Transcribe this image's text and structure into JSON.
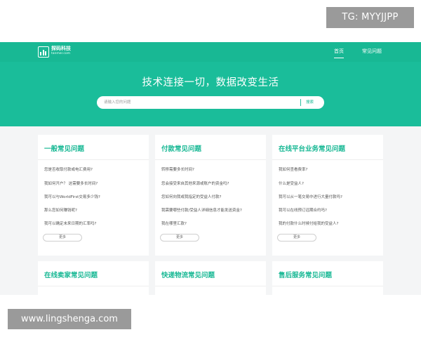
{
  "watermarks": {
    "top": "TG: MYYJJPP",
    "bottom": "www.lingshenga.com"
  },
  "header": {
    "logo_title": "探码科技",
    "logo_subtitle": "tanmer.com",
    "nav": [
      {
        "label": "首页",
        "active": true
      },
      {
        "label": "常见问题",
        "active": false
      }
    ]
  },
  "hero": {
    "title": "技术连接一切，数据改变生活",
    "search": {
      "placeholder": "请输入您的问题",
      "button": "搜索"
    }
  },
  "cards": [
    {
      "title": "一般常见问题",
      "questions": [
        "您是否收取付款或电汇费用?",
        "我如何开户？ 这需要多长时间?",
        "我可以与WorldFirst交易多少钱?",
        "那么您如何赚钱呢?",
        "我可以确定未来日期的汇率吗?"
      ],
      "more": "更多"
    },
    {
      "title": "付款常见问题",
      "questions": [
        "转移需要多长时间?",
        "您会接受来自其他来源或账户的资金吗?",
        "您如何向我或我指定的受益人付款?",
        "我需要哪些付款/受益人详细信息才能发送资金?",
        "我在哪里汇款?"
      ],
      "more": "更多"
    },
    {
      "title": "在线平台业务常见问题",
      "questions": [
        "我如何查看费率?",
        "什么是受益人?",
        "我可以从一笔交易中进行大量付款吗?",
        "我可以在线预订远期合约吗?",
        "我的付款什么时候付给我的受益人?"
      ],
      "more": "更多"
    },
    {
      "title": "在线卖家常见问题"
    },
    {
      "title": "快递物流常见问题"
    },
    {
      "title": "售后服务常见问题"
    }
  ]
}
